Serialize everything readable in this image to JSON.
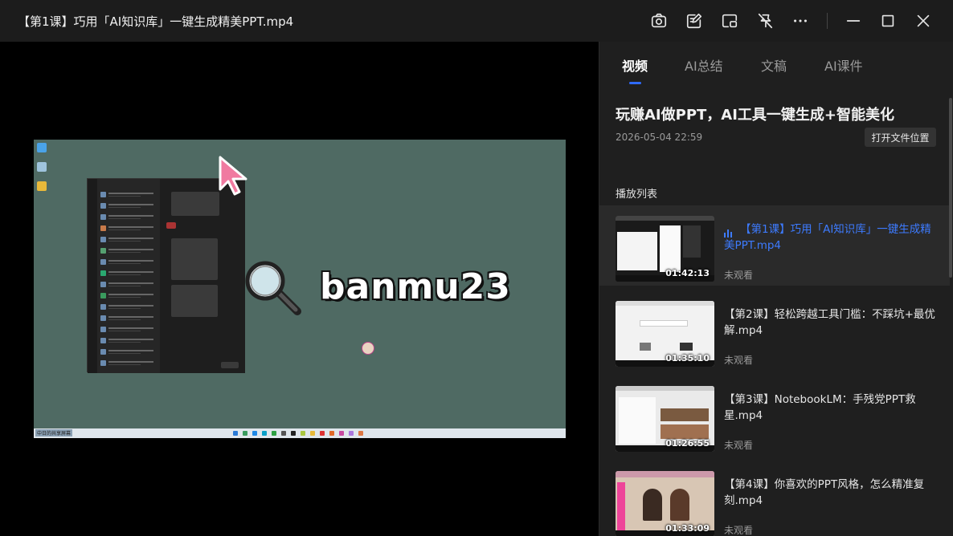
{
  "window": {
    "title": "【第1课】巧用「AI知识库」一键生成精美PPT.mp4",
    "toolbar_icons": [
      "camera-icon",
      "edit-note-icon",
      "pip-icon",
      "pin-off-icon",
      "more-icon",
      "minimize-icon",
      "maximize-icon",
      "close-icon"
    ]
  },
  "video": {
    "overlay_text": "banmu23",
    "taskbar_label": "中日的共享屏幕"
  },
  "panel": {
    "tabs": [
      {
        "label": "视频",
        "active": true
      },
      {
        "label": "AI总结",
        "active": false
      },
      {
        "label": "文稿",
        "active": false
      },
      {
        "label": "AI课件",
        "active": false
      }
    ],
    "course_title": "玩赚AI做PPT，AI工具一键生成+智能美化",
    "course_date": "2026-05-04 22:59",
    "open_location_label": "打开文件位置",
    "playlist_heading": "播放列表",
    "playlist": [
      {
        "name": "【第1课】巧用「AI知识库」一键生成精美PPT.mp4",
        "duration": "01:42:13",
        "status": "未观看",
        "playing": true
      },
      {
        "name": "【第2课】轻松跨越工具门槛：不踩坑+最优解.mp4",
        "duration": "01:35:10",
        "status": "未观看",
        "playing": false
      },
      {
        "name": "【第3课】NotebookLM：手残党PPT救星.mp4",
        "duration": "01:26:55",
        "status": "未观看",
        "playing": false
      },
      {
        "name": "【第4课】你喜欢的PPT风格，怎么精准复刻.mp4",
        "duration": "01:33:09",
        "status": "未观看",
        "playing": false
      }
    ]
  },
  "colors": {
    "accent": "#2f6bff",
    "playing_text": "#3d7bff",
    "panel_bg": "#1f1f1f",
    "titlebar_bg": "#1c1c1c"
  }
}
